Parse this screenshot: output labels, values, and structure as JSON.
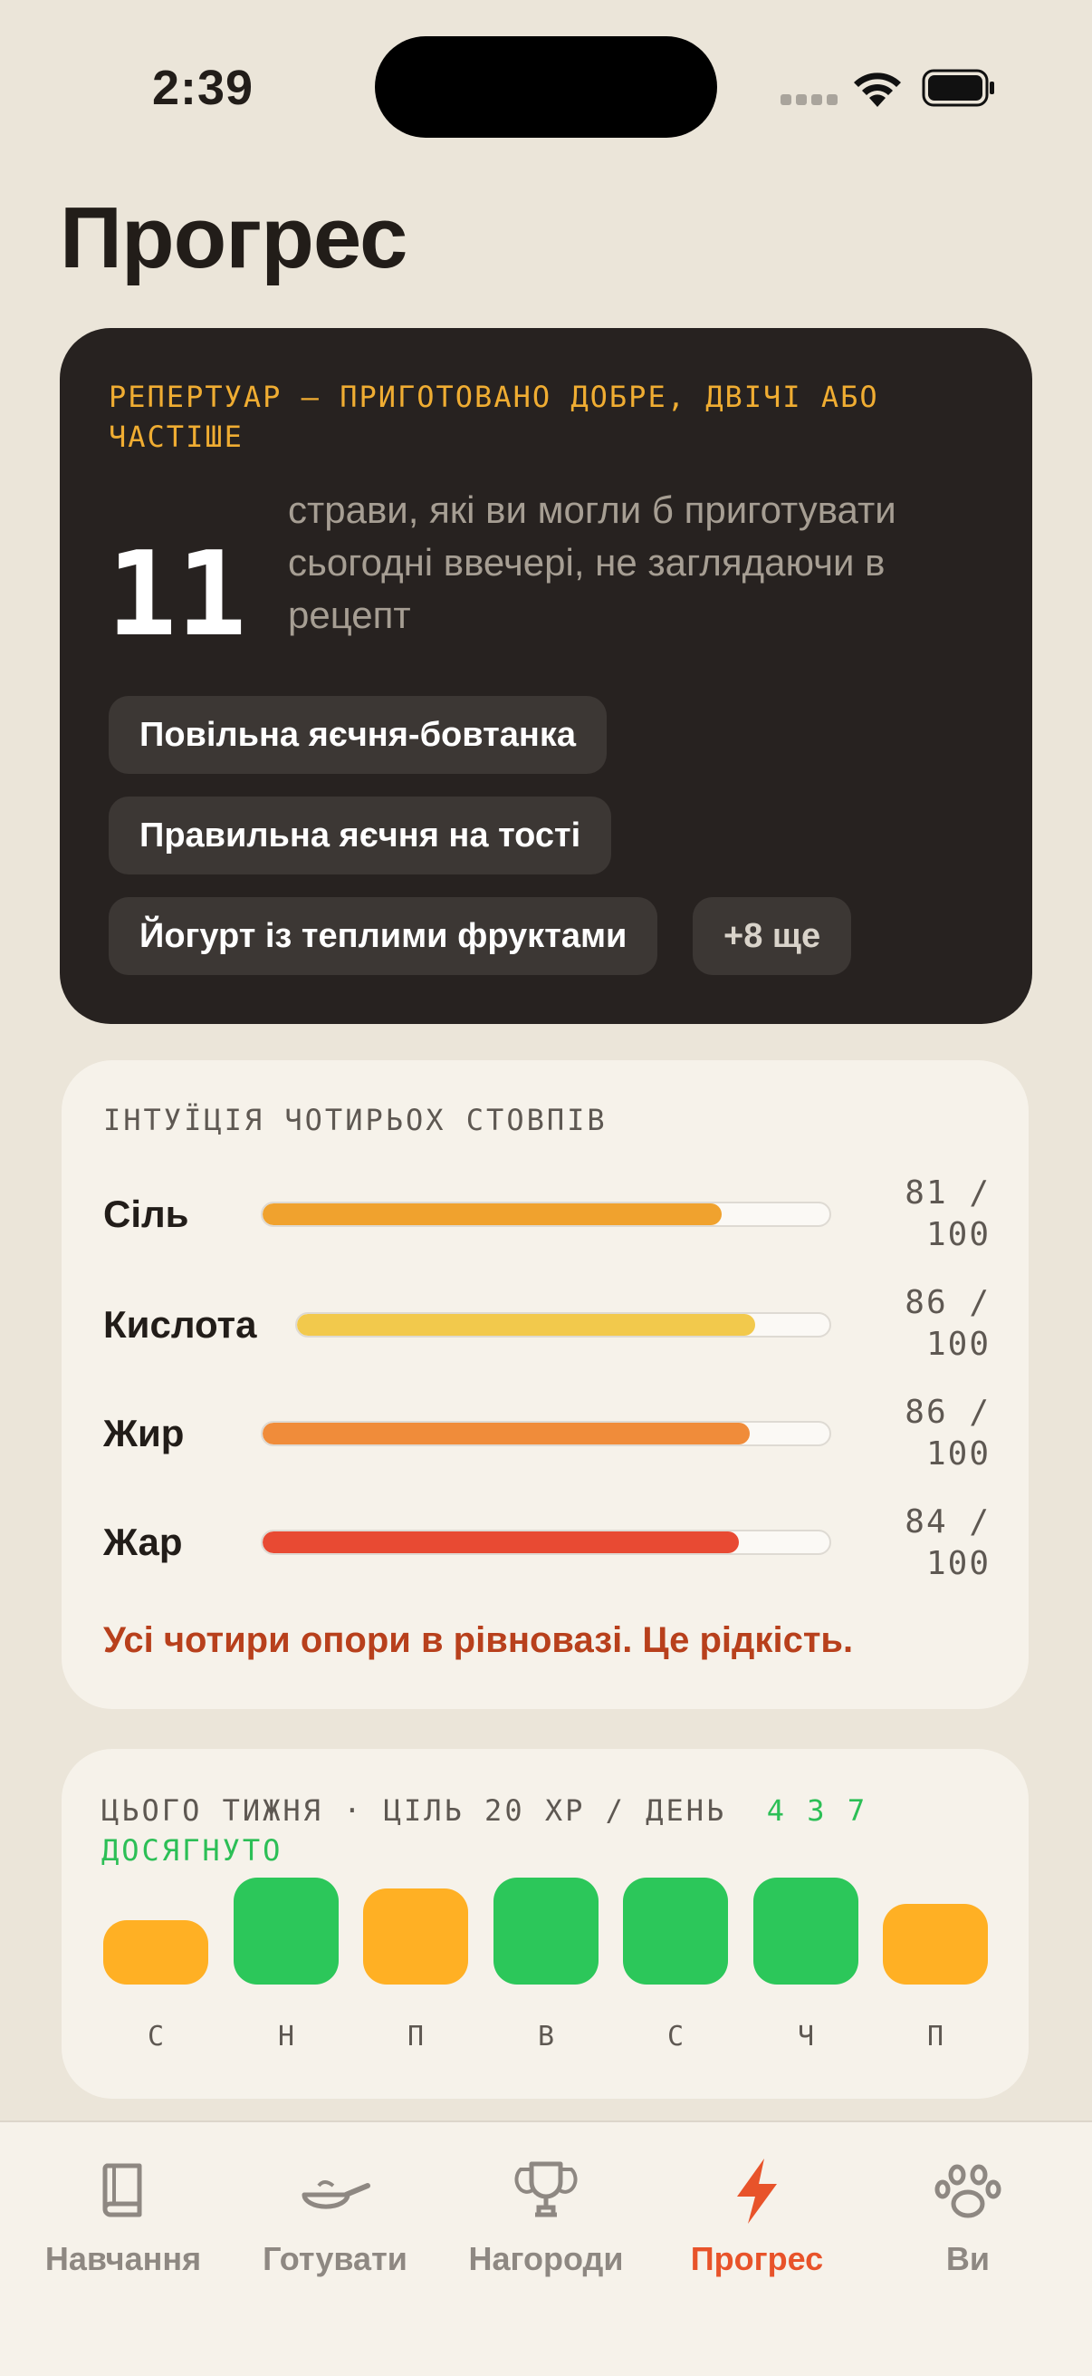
{
  "status_bar": {
    "time": "2:39"
  },
  "page_title": "Прогрес",
  "repertoire": {
    "label": "РЕПЕРТУАР — ПРИГОТОВАНО ДОБРЕ, ДВІЧІ АБО ЧАСТІШЕ",
    "count": "11",
    "description": "страви, які ви могли б приготувати сьогодні ввечері, не заглядаючи в рецепт",
    "chips": [
      "Повільна яєчня-бовтанка",
      "Правильна яєчня на тості",
      "Йогурт із теплими фруктами"
    ],
    "more": "+8 ще",
    "colors": {
      "label": "#f0ad32",
      "card": "#272220"
    }
  },
  "pillars": {
    "label": "ІНТУЇЦІЯ ЧОТИРЬОХ СТОВПІВ",
    "items": [
      {
        "name": "Сіль",
        "value": 81,
        "score": "81 / 100",
        "color": "#f0a22e"
      },
      {
        "name": "Кислота",
        "value": 86,
        "score": "86 / 100",
        "color": "#f2c94c"
      },
      {
        "name": "Жир",
        "value": 86,
        "score": "86 / 100",
        "color": "#f08c3a"
      },
      {
        "name": "Жар",
        "value": 84,
        "score": "84 / 100",
        "color": "#e84a33"
      }
    ],
    "message": "Усі чотири опори в рівновазі. Це рідкість."
  },
  "week": {
    "label": "ЦЬОГО ТИЖНЯ · ЦІЛЬ 20 XP / ДЕНЬ",
    "achieved": "4 3 7 ДОСЯГНУТО",
    "days": [
      {
        "letter": "С",
        "level": 0.6,
        "status": "partial",
        "color": "#ffb024"
      },
      {
        "letter": "Н",
        "level": 1.0,
        "status": "met",
        "color": "#2cc75a"
      },
      {
        "letter": "П",
        "level": 0.9,
        "status": "partial",
        "color": "#ffb024"
      },
      {
        "letter": "В",
        "level": 1.0,
        "status": "met",
        "color": "#2cc75a"
      },
      {
        "letter": "С",
        "level": 1.0,
        "status": "met",
        "color": "#2cc75a"
      },
      {
        "letter": "Ч",
        "level": 1.0,
        "status": "met",
        "color": "#2cc75a"
      },
      {
        "letter": "П",
        "level": 0.75,
        "status": "partial",
        "color": "#ffb024"
      }
    ]
  },
  "tabs": [
    {
      "label": "Навчання",
      "icon": "book-icon",
      "active": false
    },
    {
      "label": "Готувати",
      "icon": "frying-pan-icon",
      "active": false
    },
    {
      "label": "Нагороди",
      "icon": "trophy-icon",
      "active": false
    },
    {
      "label": "Прогрес",
      "icon": "lightning-icon",
      "active": true
    },
    {
      "label": "Ви",
      "icon": "paw-icon",
      "active": false
    }
  ],
  "accent_color": "#e8532a"
}
